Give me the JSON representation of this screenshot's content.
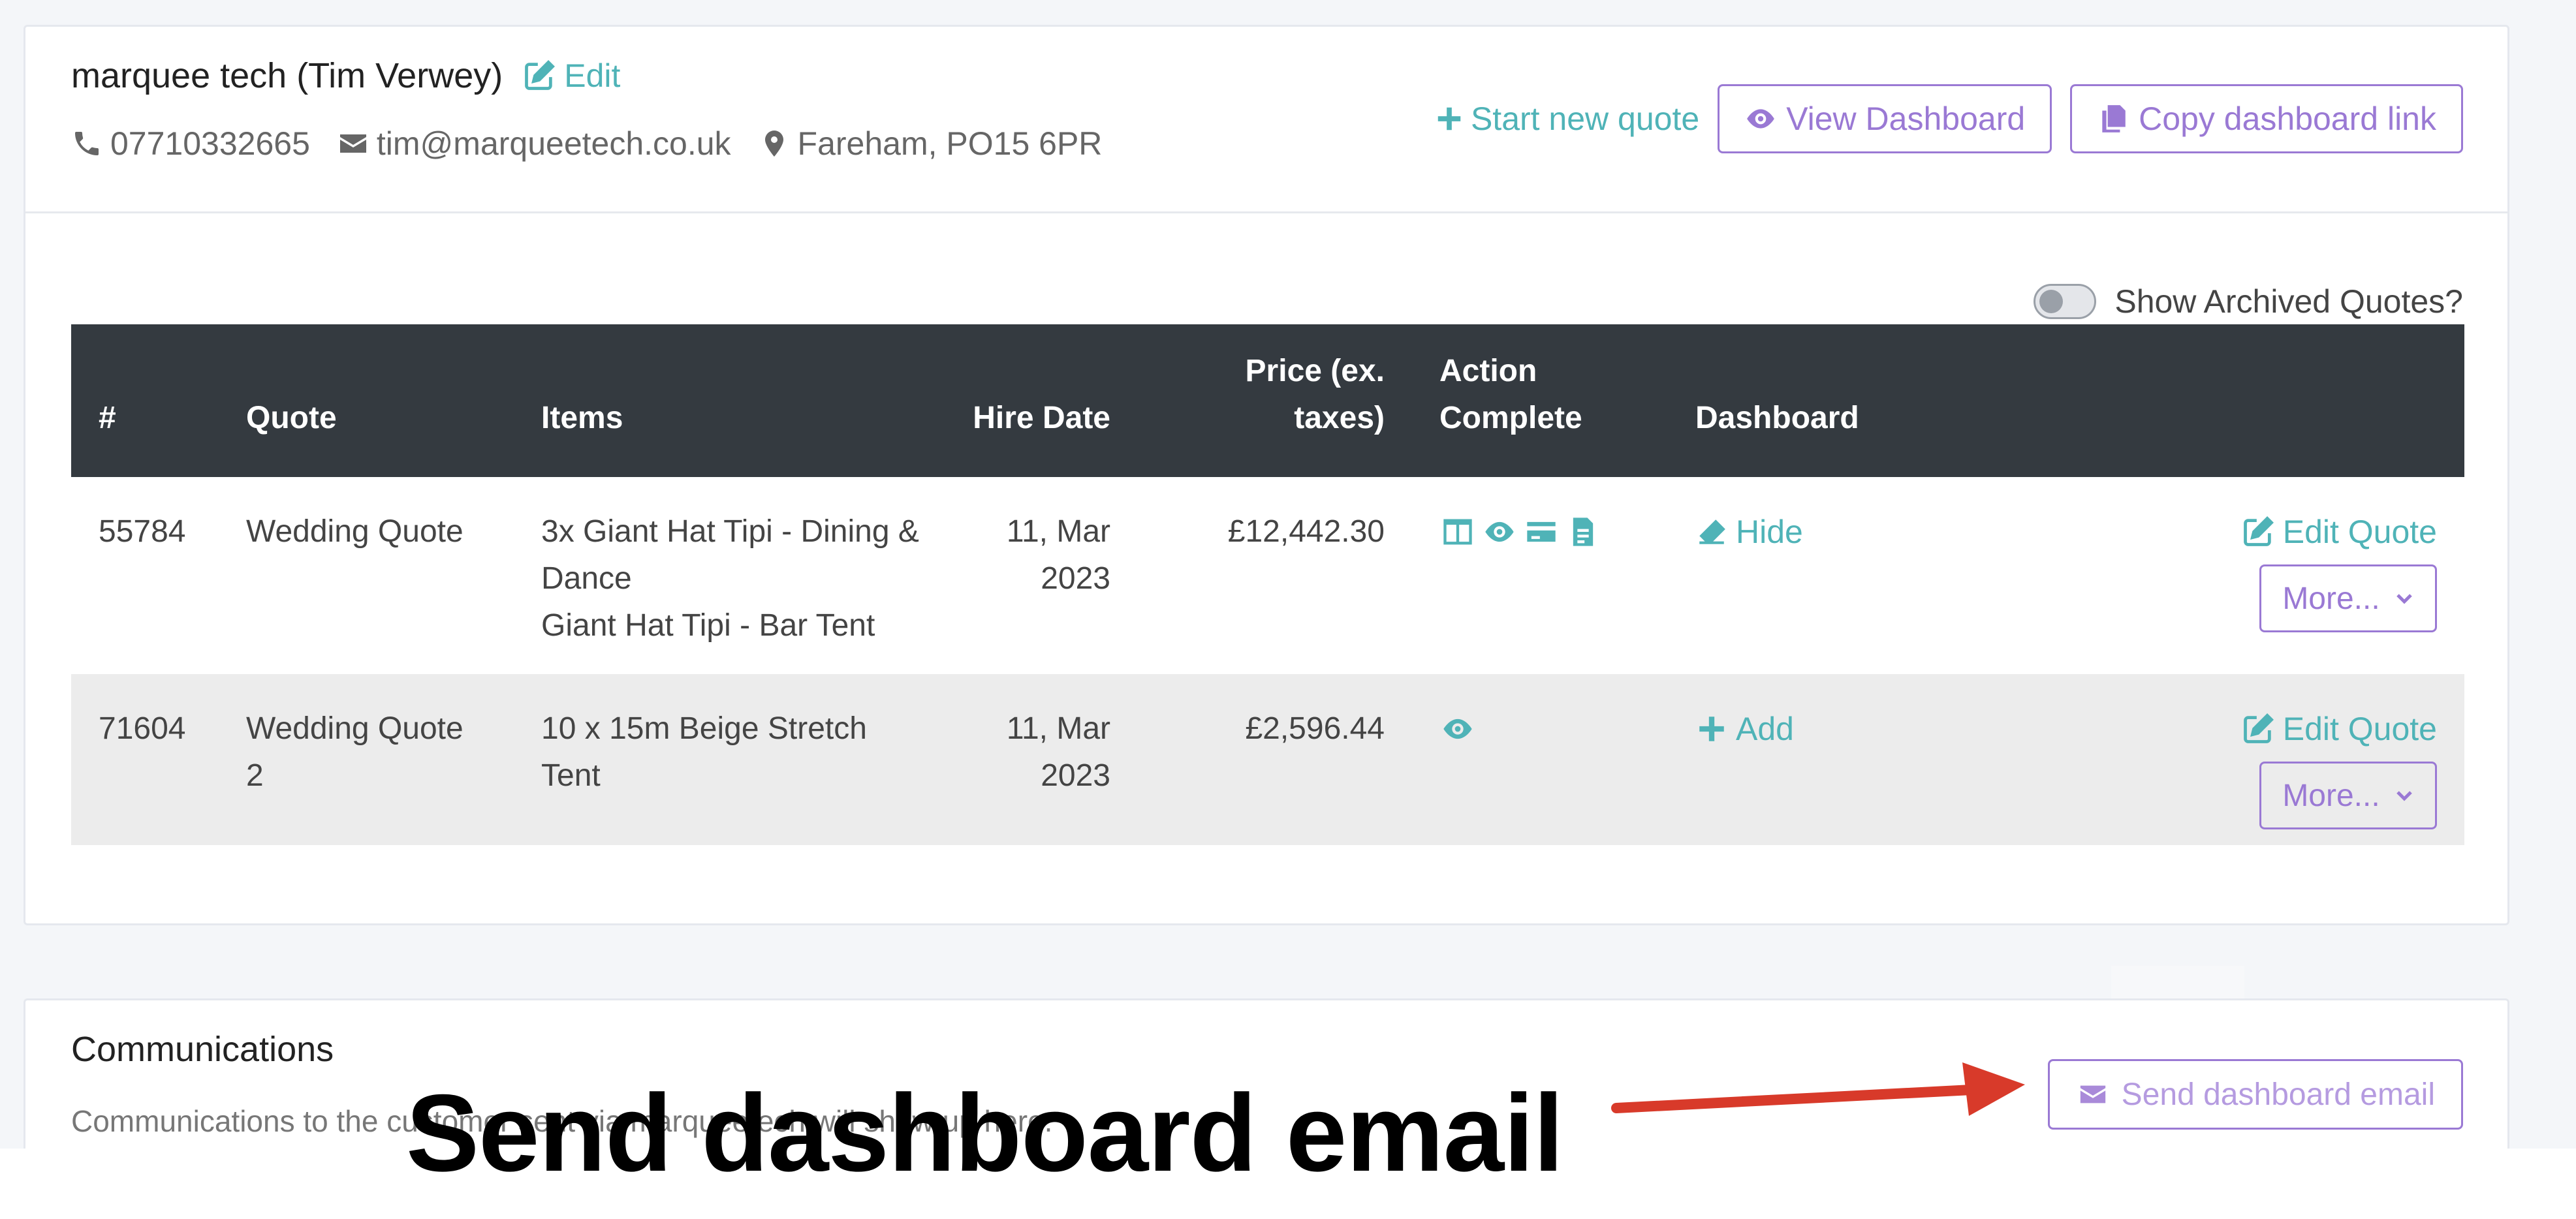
{
  "customer": {
    "name": "marquee tech (Tim Verwey)",
    "edit_label": "Edit",
    "phone": "07710332665",
    "email": "tim@marqueetech.co.uk",
    "location": "Fareham, PO15 6PR",
    "phone_icon": "phone-icon",
    "email_icon": "envelope-icon",
    "location_icon": "map-marker-icon"
  },
  "header_actions": {
    "start_quote": "Start new quote",
    "view_dashboard": "View Dashboard",
    "copy_link": "Copy dashboard link"
  },
  "archived_toggle": {
    "label": "Show Archived Quotes?",
    "on": false
  },
  "table": {
    "headers": {
      "num": "#",
      "quote": "Quote",
      "items": "Items",
      "hire_date_1": "Hire Date",
      "price_1": "Price (ex.",
      "price_2": "taxes)",
      "action_1": "Action",
      "action_2": "Complete",
      "dashboard": "Dashboard"
    },
    "rows": [
      {
        "num": "55784",
        "quote": "Wedding Quote",
        "items_1": "3x Giant Hat Tipi - Dining &",
        "items_2": "Dance",
        "items_3": "Giant Hat Tipi - Bar Tent",
        "date_1": "11, Mar",
        "date_2": "2023",
        "price": "£12,442.30",
        "action_icons": [
          "columns-icon",
          "eye-icon",
          "credit-card-icon",
          "file-text-icon"
        ],
        "dashboard_label": "Hide",
        "dashboard_icon": "eraser-icon",
        "edit_label": "Edit Quote",
        "more_label": "More..."
      },
      {
        "num": "71604",
        "quote_1": "Wedding Quote",
        "quote_2": "2",
        "items_1": "10 x 15m Beige Stretch Tent",
        "date_1": "11, Mar",
        "date_2": "2023",
        "price": "£2,596.44",
        "action_icons": [
          "eye-icon"
        ],
        "dashboard_label": "Add",
        "dashboard_icon": "plus-icon",
        "edit_label": "Edit Quote",
        "more_label": "More..."
      }
    ]
  },
  "communications": {
    "title": "Communications",
    "subtitle": "Communications to the customer sent via marqueetech will show up here.",
    "send_button": "Send dashboard email"
  },
  "annotation": {
    "text": "Send dashboard email"
  },
  "colors": {
    "teal": "#4fb3b7",
    "purple": "#9a79d4",
    "header_dark": "#343a40",
    "arrow_red": "#d83a2a"
  }
}
